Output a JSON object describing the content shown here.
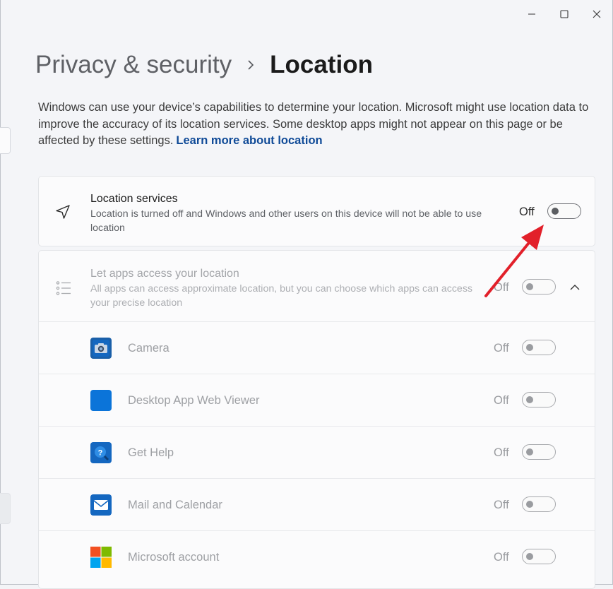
{
  "window": {
    "minimize_label": "Minimize",
    "maximize_label": "Maximize",
    "close_label": "Close"
  },
  "breadcrumb": {
    "parent": "Privacy & security",
    "current": "Location"
  },
  "description": {
    "text": "Windows can use your device’s capabilities to determine your location. Microsoft might use location data to improve the accuracy of its location services. Some desktop apps might not appear on this page or be affected by these settings.",
    "link": "Learn more about location"
  },
  "location_services": {
    "title": "Location services",
    "subtitle": "Location is turned off and Windows and other users on this device will not be able to use location",
    "state": "Off",
    "enabled": false,
    "icon": "navigation-arrow-icon"
  },
  "let_apps_access": {
    "title": "Let apps access your location",
    "subtitle": "All apps can access approximate location, but you can choose which apps can access your precise location",
    "state": "Off",
    "enabled": false,
    "icon": "bulleted-list-icon",
    "expanded": true
  },
  "apps": [
    {
      "name": "Camera",
      "state": "Off",
      "icon": "camera-app-icon",
      "color": "#0b6cc4"
    },
    {
      "name": "Desktop App Web Viewer",
      "state": "Off",
      "icon": "web-viewer-app-icon",
      "color": "#0b74d9"
    },
    {
      "name": "Get Help",
      "state": "Off",
      "icon": "get-help-app-icon",
      "color": "#0b6cc4"
    },
    {
      "name": "Mail and Calendar",
      "state": "Off",
      "icon": "mail-calendar-app-icon",
      "color": "#0b6cc4"
    },
    {
      "name": "Microsoft account",
      "state": "Off",
      "icon": "microsoft-logo-icon",
      "color": "#f25022"
    }
  ],
  "colors": {
    "link": "#0f4a97",
    "annotation_arrow": "#e2202a"
  }
}
